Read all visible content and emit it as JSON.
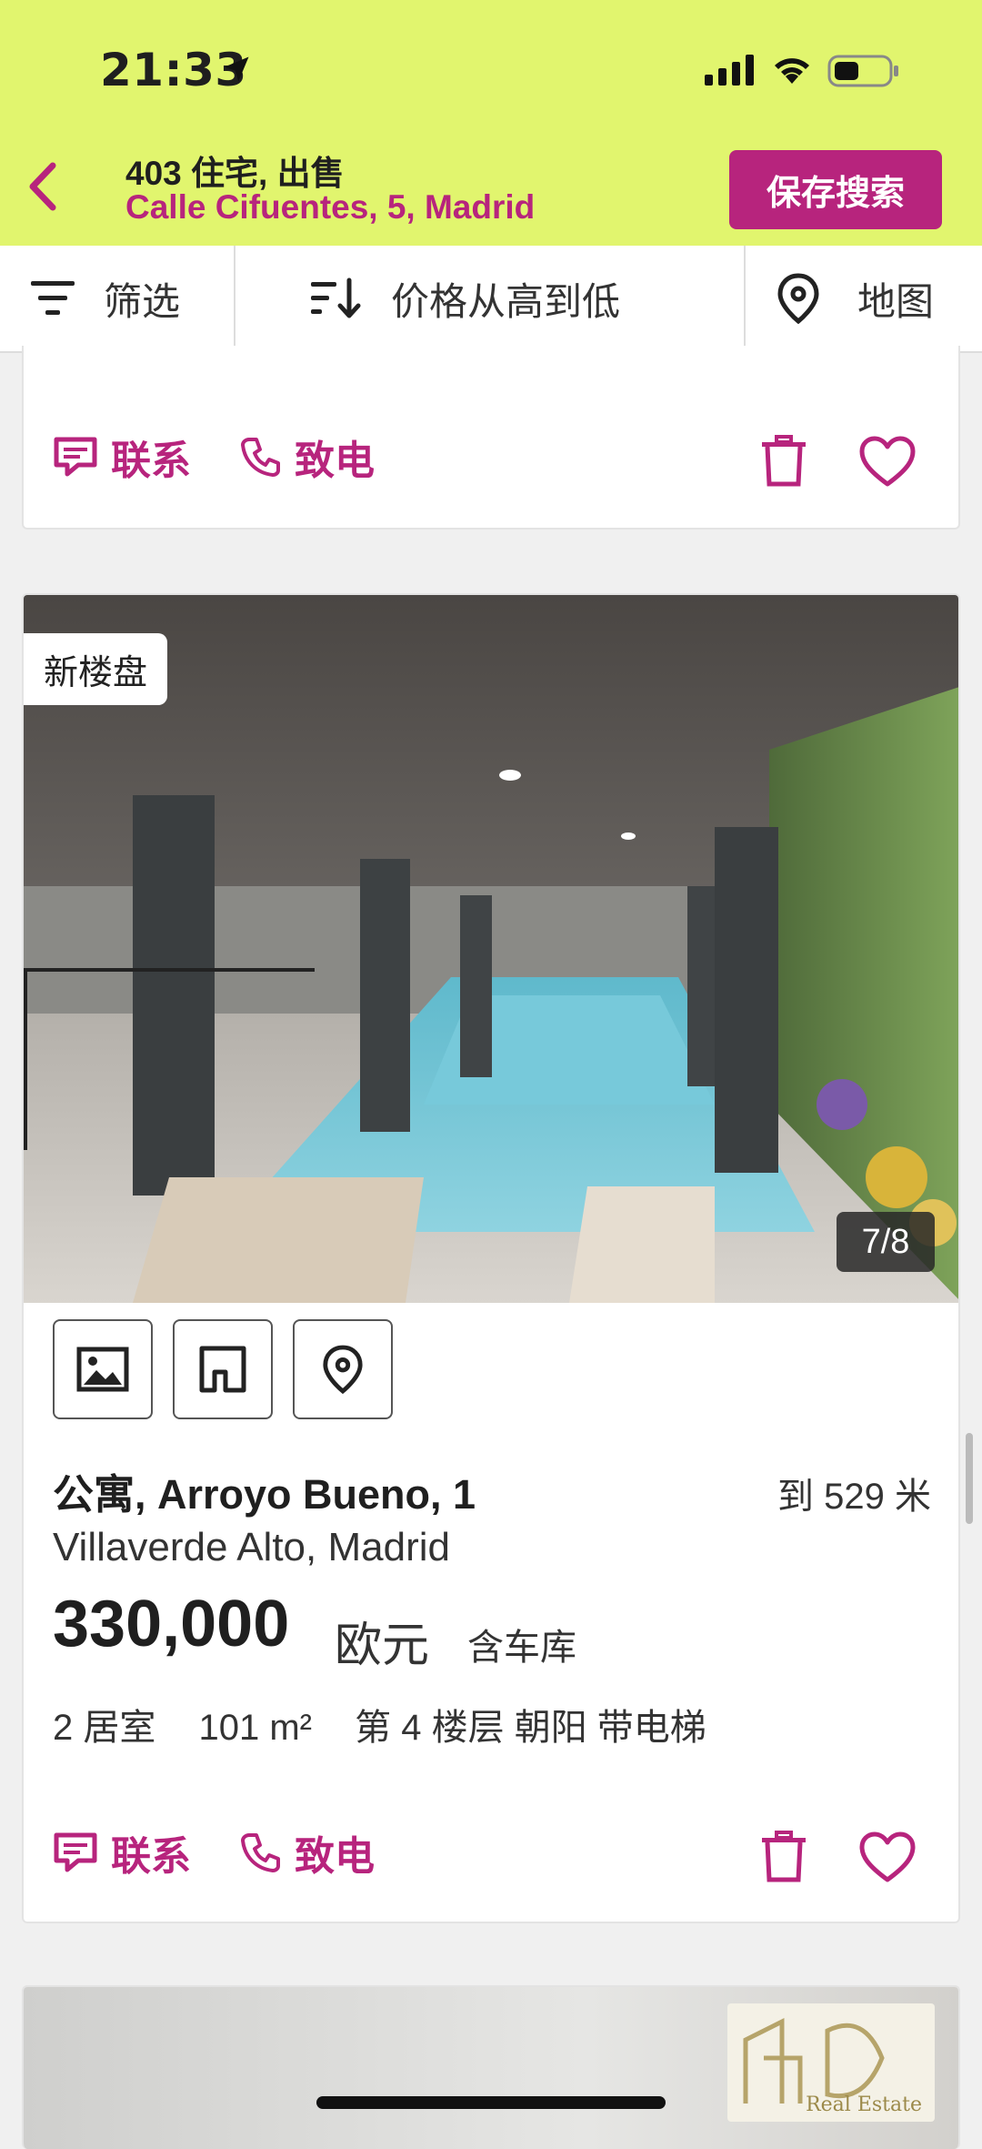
{
  "status": {
    "time": "21:33"
  },
  "header": {
    "title": "403 住宅, 出售",
    "subtitle": "Calle Cifuentes, 5, Madrid",
    "save_search": "保存搜索"
  },
  "filters": {
    "filter": "筛选",
    "sort": "价格从高到低",
    "map": "地图"
  },
  "card_actions": {
    "contact": "联系",
    "call": "致电"
  },
  "listing": {
    "badge": "新楼盘",
    "photo_counter": "7/8",
    "type_address": "公寓, Arroyo Bueno, 1",
    "distance": "到 529 米",
    "area": "Villaverde Alto, Madrid",
    "price": "330,000",
    "currency": "欧元",
    "extra": "含车库",
    "features": [
      "2 居室",
      "101 m²",
      "第 4 楼层 朝阳 带电梯"
    ]
  },
  "next_listing": {
    "logo_text": "Real Estate"
  },
  "colors": {
    "header_bg": "#e1f56e",
    "accent": "#b7247d"
  }
}
